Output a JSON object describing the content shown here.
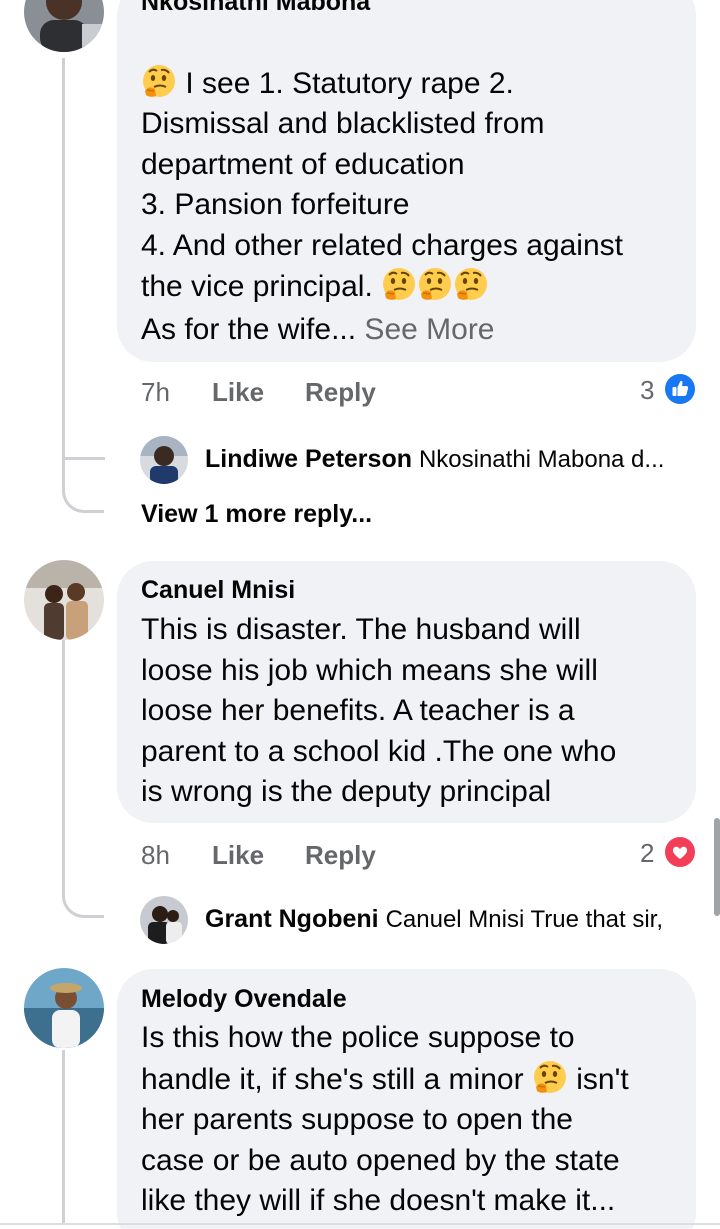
{
  "comments": [
    {
      "author": "Nkosinathi Mabona",
      "text_parts": [
        " I see 1. Statutory rape 2.\nDismissal and blacklisted from\ndepartment of education\n3. Pansion forfeiture\n4. And other related charges against\nthe vice principal. ",
        "As for the wife..."
      ],
      "see_more": " See More",
      "time": "7h",
      "like_label": "Like",
      "reply_label": "Reply",
      "reaction_count": "3",
      "reaction_icon": "like-icon",
      "replies": [
        {
          "name": "Lindiwe Peterson",
          "text": "Nkosinathi Mabona d..."
        }
      ],
      "more_replies": "View 1 more reply..."
    },
    {
      "author": "Canuel Mnisi",
      "text": "This is disaster. The husband will\nloose his job which means she will\nloose her benefits. A teacher is a\nparent to a school kid .The one who\nis wrong is the deputy principal",
      "time": "8h",
      "like_label": "Like",
      "reply_label": "Reply",
      "reaction_count": "2",
      "reaction_icon": "love-icon",
      "replies": [
        {
          "name": "Grant Ngobeni",
          "text": "Canuel Mnisi True that sir,"
        }
      ]
    },
    {
      "author": "Melody Ovendale",
      "text_parts": [
        "Is this how the police suppose to\nhandle it, if she's still a minor ",
        " isn't\nher parents suppose to open the\ncase or be auto opened by the state\nlike they will if she doesn't make it..."
      ]
    }
  ],
  "colors": {
    "bubble": "#f0f2f5",
    "muted": "#65676b",
    "like_blue": "#1877f2",
    "love_red": "#f33e58",
    "thread": "#ced0d4"
  }
}
